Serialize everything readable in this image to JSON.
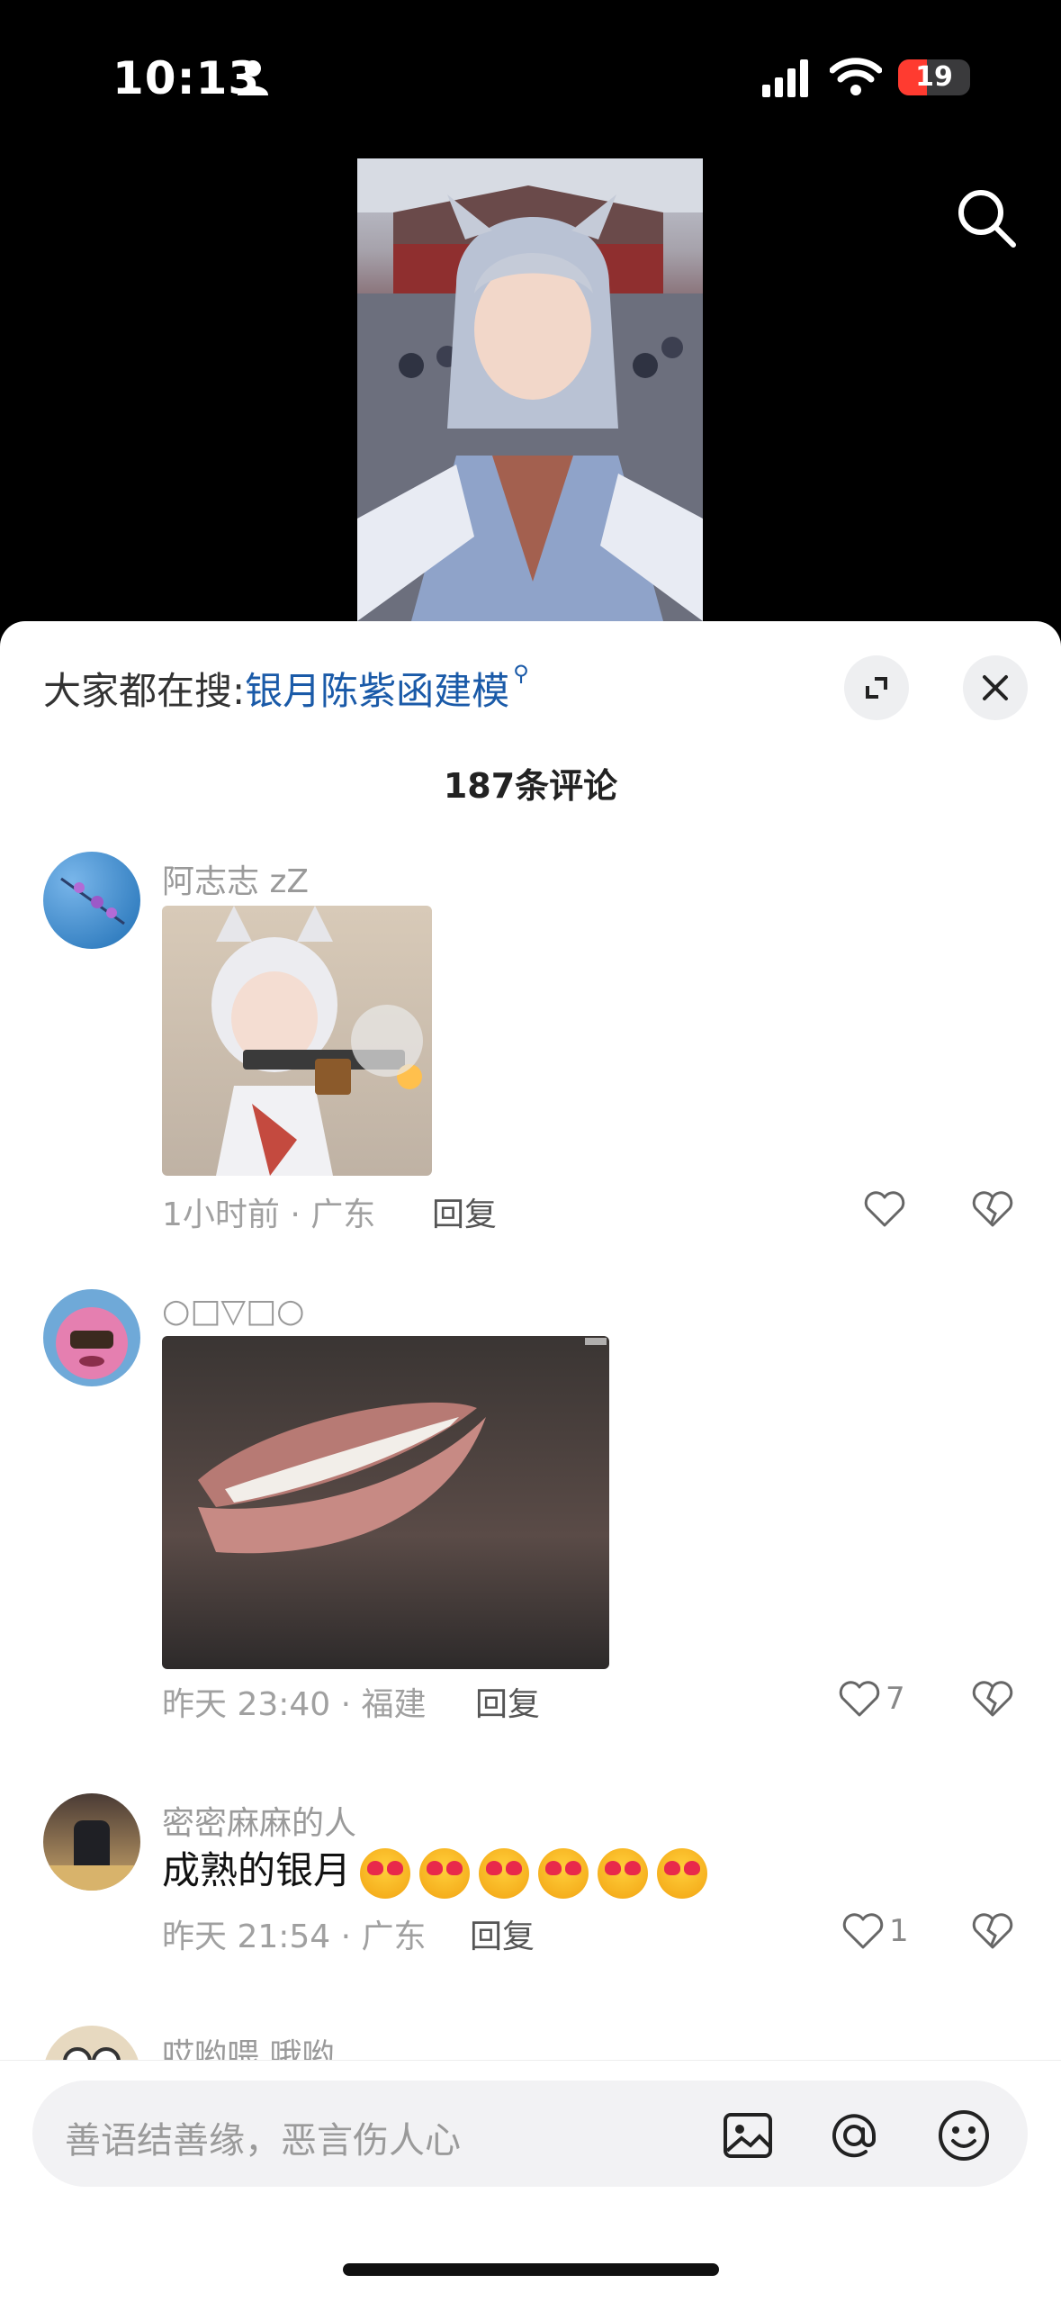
{
  "status_bar": {
    "time": "10:13",
    "battery_level": "19"
  },
  "video": {
    "search_icon": "search-icon"
  },
  "sheet": {
    "hot_search_label": "大家都在搜:",
    "hot_search_term": "银月陈紫函建模",
    "comment_count": "187条评论"
  },
  "comments": [
    {
      "username": "阿志志 zZ",
      "has_image": true,
      "meta": "1小时前 · 广东",
      "reply_label": "回复",
      "like_count": ""
    },
    {
      "username": "○□▽□○",
      "has_image": true,
      "meta": "昨天 23:40 · 福建",
      "reply_label": "回复",
      "like_count": "7"
    },
    {
      "username": "密密麻麻的人",
      "text": "成熟的银月",
      "emoji_count": 6,
      "meta": "昨天 21:54 · 广东",
      "reply_label": "回复",
      "like_count": "1"
    },
    {
      "username": "哎哟喂 哦哟"
    }
  ],
  "input_bar": {
    "placeholder": "善语结善缘，恶言伤人心",
    "icons": [
      "image-icon",
      "at-icon",
      "emoji-icon"
    ]
  },
  "colors": {
    "accent_link": "#1a5aa8",
    "battery_low": "#ff3b30"
  }
}
